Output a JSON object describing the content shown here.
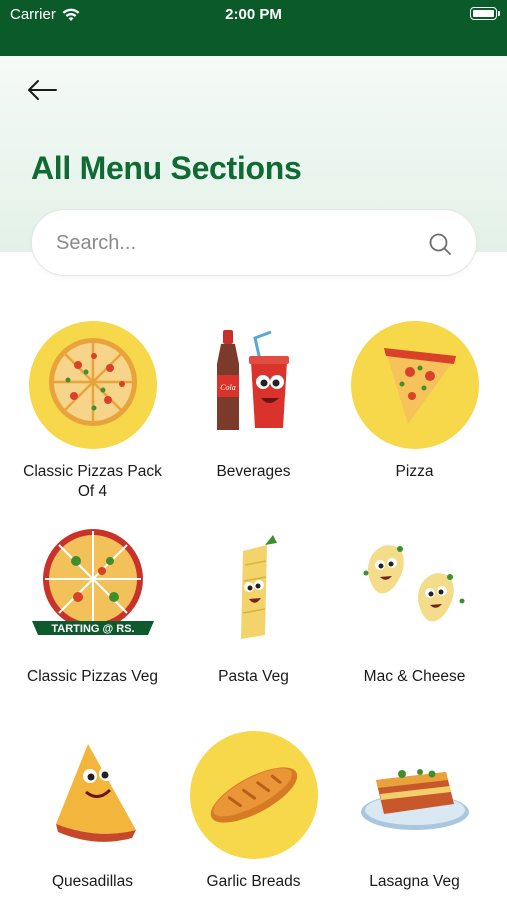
{
  "status_bar": {
    "carrier": "Carrier",
    "time": "2:00 PM"
  },
  "header": {
    "title": "All Menu Sections",
    "back_icon": "arrow-left-icon"
  },
  "search": {
    "placeholder": "Search...",
    "value": "",
    "icon": "search-icon"
  },
  "categories": [
    {
      "label": "Classic Pizzas Pack Of 4",
      "image": "pizza-whole-icon"
    },
    {
      "label": "Beverages",
      "image": "cola-drinks-icon"
    },
    {
      "label": "Pizza",
      "image": "pizza-slice-icon"
    },
    {
      "label": "Classic Pizzas Veg",
      "image": "pizza-banner-icon",
      "banner_text": "TARTING @ RS."
    },
    {
      "label": "Pasta Veg",
      "image": "penne-pasta-icon"
    },
    {
      "label": "Mac & Cheese",
      "image": "macaroni-icon"
    },
    {
      "label": "Quesadillas",
      "image": "quesadilla-icon"
    },
    {
      "label": "Garlic Breads",
      "image": "garlic-bread-icon"
    },
    {
      "label": "Lasagna Veg",
      "image": "lasagna-icon"
    }
  ],
  "colors": {
    "status_bar": "#0a5a2a",
    "title_green": "#0f6b33",
    "yellow": "#f7d84a"
  }
}
